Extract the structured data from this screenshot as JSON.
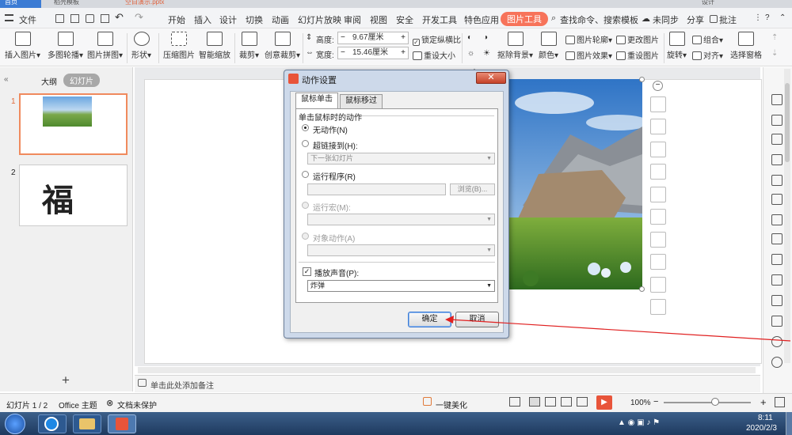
{
  "title_tabs": [
    "首页",
    "稻壳模板",
    "空白演示.pptx"
  ],
  "title_right": "设计",
  "menu": {
    "file": "文件",
    "tabs": [
      "开始",
      "插入",
      "设计",
      "切换",
      "动画",
      "幻灯片放映",
      "审阅",
      "视图",
      "安全",
      "开发工具",
      "特色应用",
      "图片工具"
    ],
    "search": "查找命令、搜索模板",
    "sync": "未同步",
    "share": "分享",
    "comment": "批注"
  },
  "ribbon": {
    "insert_pic": "插入图片",
    "multi_pic": "多图轮播",
    "collage": "图片拼图",
    "shape": "形状",
    "compress": "压缩图片",
    "smart_zoom": "智能缩放",
    "crop": "裁剪",
    "creative_crop": "创意裁剪",
    "height_label": "高度:",
    "height_value": "9.67厘米",
    "width_label": "宽度:",
    "width_value": "15.46厘米",
    "lock_ratio": "锁定纵横比",
    "reset_size": "重设大小",
    "remove_bg": "抠除背景",
    "color": "颜色",
    "outline": "图片轮廓",
    "effect": "图片效果",
    "change_pic": "更改图片",
    "reset_pic": "重设图片",
    "group": "组合",
    "rotate": "旋转",
    "align": "对齐",
    "selection_pane": "选择窗格"
  },
  "left_panel": {
    "tab_outline": "大纲",
    "tab_slides": "幻灯片",
    "slides": [
      {
        "num": "1",
        "text": ""
      },
      {
        "num": "2",
        "text": "福"
      }
    ],
    "add": "+"
  },
  "notes_placeholder": "单击此处添加备注",
  "status": {
    "slide_info": "幻灯片 1 / 2",
    "theme": "Office 主题",
    "protect": "文档未保护",
    "beautify": "一键美化",
    "zoom": "100%"
  },
  "taskbar": {
    "time": "8:11",
    "date": "2020/2/3"
  },
  "dialog": {
    "title": "动作设置",
    "tab_click": "鼠标单击",
    "tab_hover": "鼠标移过",
    "group_title": "单击鼠标时的动作",
    "opt_none": "无动作(N)",
    "opt_hyperlink": "超链接到(H):",
    "hyperlink_value": "下一张幻灯片",
    "opt_program": "运行程序(R)",
    "browse": "浏览(B)...",
    "opt_macro": "运行宏(M):",
    "opt_object": "对象动作(A)",
    "play_sound": "播放声音(P):",
    "sound_value": "炸弹",
    "ok": "确定",
    "cancel": "取消"
  },
  "colors": {
    "accent": "#f7735a",
    "dialog_frame": "#cdd9ea",
    "annotation": "#e02020"
  }
}
